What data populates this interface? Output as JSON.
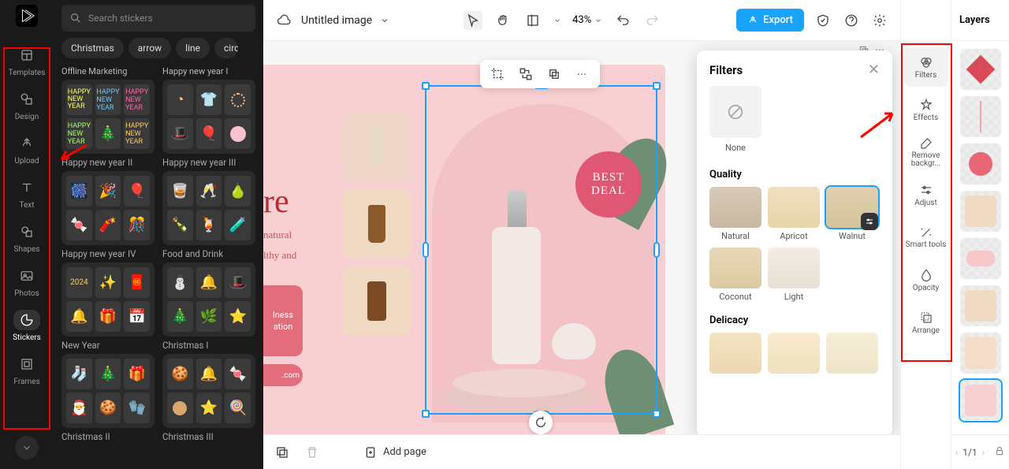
{
  "app": {
    "title": "Untitled image",
    "zoom": "43%",
    "export_label": "Export"
  },
  "left_rail": {
    "items": [
      {
        "label": "Templates"
      },
      {
        "label": "Design"
      },
      {
        "label": "Upload"
      },
      {
        "label": "Text"
      },
      {
        "label": "Shapes"
      },
      {
        "label": "Photos"
      },
      {
        "label": "Stickers"
      },
      {
        "label": "Frames"
      }
    ]
  },
  "stickers": {
    "search_placeholder": "Search stickers",
    "tags": [
      "Christmas",
      "arrow",
      "line",
      "circle"
    ],
    "sections_left": [
      "Offline Marketing",
      "Happy new year II",
      "Happy new year IV",
      "New Year",
      "Christmas II"
    ],
    "sections_right": [
      "Happy new year I",
      "Happy new year III",
      "Food and Drink",
      "Christmas I",
      "Christmas III"
    ]
  },
  "canvas": {
    "title_text": "re",
    "subtitle_line1": "natural",
    "subtitle_line2": "lthy and",
    "badge_line1": "lness",
    "badge_line2": "ation",
    "url_text": ".com",
    "best_deal_line1": "BEST",
    "best_deal_line2": "DEAL"
  },
  "filters": {
    "title": "Filters",
    "none_label": "None",
    "quality_label": "Quality",
    "quality_items": [
      "Natural",
      "Apricot",
      "Walnut",
      "Coconut",
      "Light"
    ],
    "delicacy_label": "Delicacy"
  },
  "tools": {
    "items": [
      {
        "label": "Filters"
      },
      {
        "label": "Effects"
      },
      {
        "label": "Remove backgr..."
      },
      {
        "label": "Adjust"
      },
      {
        "label": "Smart tools"
      },
      {
        "label": "Opacity"
      },
      {
        "label": "Arrange"
      }
    ]
  },
  "layers": {
    "title": "Layers",
    "pager": "1/1"
  },
  "bottom": {
    "add_page": "Add page"
  }
}
